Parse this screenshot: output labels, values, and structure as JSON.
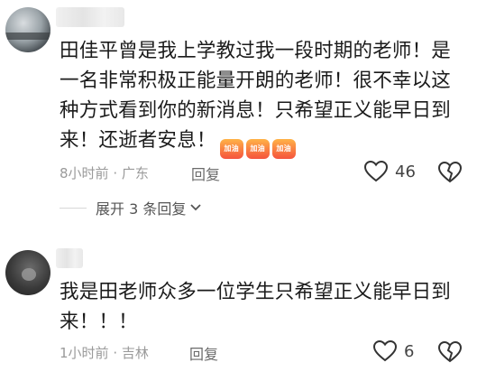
{
  "comments": [
    {
      "lines": [
        "田佳平曾是我上学教过我一段时期的老师！是",
        "一名非常积极正能量开朗的老师！很不幸以这",
        "种方式看到你的新消息！只希望正义能早日到",
        "来！还逝者安息！"
      ],
      "badge_text": "加油",
      "time": "8小时前",
      "location": "广东",
      "reply_label": "回复",
      "likes": "46"
    },
    {
      "lines": [
        "我是田老师众多一位学生只希望正义能早日到",
        "来！！！"
      ],
      "time": "1小时前",
      "location": "吉林",
      "reply_label": "回复",
      "likes": "6"
    }
  ],
  "expand": {
    "label": "展开 3 条回复"
  },
  "icons": [
    "heart-outline-icon",
    "broken-heart-icon",
    "chevron-down-icon"
  ],
  "colors": {
    "text": "#1b1b1b",
    "meta": "#9a9a9a",
    "badge": "#f5533d"
  }
}
